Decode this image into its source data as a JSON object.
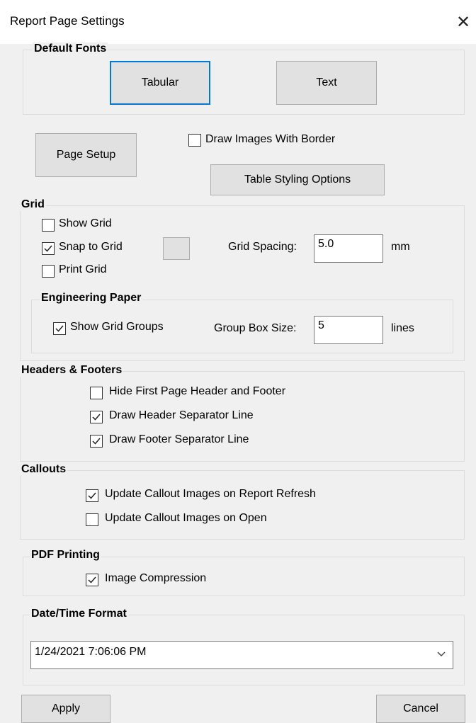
{
  "window": {
    "title": "Report Page Settings"
  },
  "default_fonts": {
    "legend": "Default Fonts",
    "tabular_label": "Tabular",
    "text_label": "Text"
  },
  "top": {
    "page_setup_label": "Page Setup",
    "draw_images_border_label": "Draw Images With Border",
    "draw_images_border_checked": false,
    "table_styling_label": "Table Styling Options"
  },
  "grid": {
    "legend": "Grid",
    "show_grid_label": "Show Grid",
    "show_grid_checked": false,
    "snap_to_grid_label": "Snap to Grid",
    "snap_to_grid_checked": true,
    "print_grid_label": "Print Grid",
    "print_grid_checked": false,
    "grid_spacing_label": "Grid Spacing:",
    "grid_spacing_value": "5.0",
    "grid_spacing_unit": "mm"
  },
  "engineering_paper": {
    "legend": "Engineering Paper",
    "show_grid_groups_label": "Show Grid Groups",
    "show_grid_groups_checked": true,
    "group_box_size_label": "Group Box Size:",
    "group_box_size_value": "5",
    "group_box_size_unit": "lines"
  },
  "headers_footers": {
    "legend": "Headers & Footers",
    "hide_first_page_label": "Hide First Page Header and Footer",
    "hide_first_page_checked": false,
    "draw_header_sep_label": "Draw Header Separator Line",
    "draw_header_sep_checked": true,
    "draw_footer_sep_label": "Draw Footer Separator Line",
    "draw_footer_sep_checked": true
  },
  "callouts": {
    "legend": "Callouts",
    "update_on_refresh_label": "Update Callout Images on Report Refresh",
    "update_on_refresh_checked": true,
    "update_on_open_label": "Update Callout Images on Open",
    "update_on_open_checked": false
  },
  "pdf_printing": {
    "legend": "PDF Printing",
    "image_compression_label": "Image Compression",
    "image_compression_checked": true
  },
  "datetime_format": {
    "legend": "Date/Time Format",
    "selected_value": "1/24/2021 7:06:06 PM"
  },
  "footer": {
    "apply_label": "Apply",
    "cancel_label": "Cancel"
  },
  "colors": {
    "window_bg": "#f0f0f0",
    "focus_border": "#0078d7"
  }
}
